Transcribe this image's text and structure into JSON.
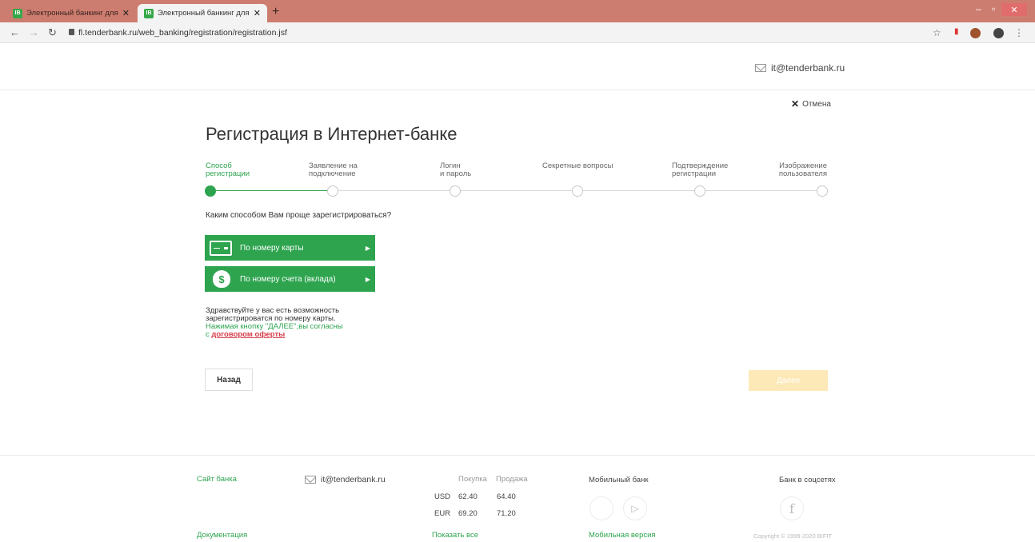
{
  "browser": {
    "tabs": [
      {
        "favicon": "IB",
        "title": "Электронный банкинг для част"
      },
      {
        "favicon": "IB",
        "title": "Электронный банкинг для част"
      }
    ],
    "url": "fl.tenderbank.ru/web_banking/registration/registration.jsf"
  },
  "header": {
    "email": "it@tenderbank.ru",
    "cancel_label": "Отмена"
  },
  "page": {
    "title": "Регистрация в Интернет-банке",
    "steps": [
      {
        "line1": "Способ",
        "line2": "регистрации"
      },
      {
        "line1": "Заявление на",
        "line2": "подключение"
      },
      {
        "line1": "Логин",
        "line2": "и пароль"
      },
      {
        "line1": "Секретные вопросы",
        "line2": ""
      },
      {
        "line1": "Подтверждение",
        "line2": "регистрации"
      },
      {
        "line1": "Изображение",
        "line2": "пользователя"
      }
    ],
    "question": "Каким способом Вам проще зарегистрироваться?",
    "methods": {
      "card": "По номеру карты",
      "account": "По номеру счета (вклада)"
    },
    "info": {
      "line1": "Здравствуйте у вас есть возможность",
      "line2": "зарегистрироватся по номеру карты.",
      "line3": "Нажимая кнопку \"ДАЛЕЕ\",вы согласны",
      "line4_prefix": "с ",
      "offer_link": "договором оферты"
    },
    "back_label": "Назад",
    "next_label": "Далее",
    "active_step": 0
  },
  "footer": {
    "site_link": "Сайт банка",
    "email": "it@tenderbank.ru",
    "rates": {
      "buy_label": "Покупка",
      "sell_label": "Продажа",
      "rows": [
        {
          "currency": "USD",
          "buy": "62.40",
          "sell": "64.40"
        },
        {
          "currency": "EUR",
          "buy": "69.20",
          "sell": "71.20"
        }
      ],
      "show_all": "Показать все"
    },
    "mobile_title": "Мобильный банк",
    "mobile_version": "Мобильная версия",
    "social_title": "Банк в соцсетях",
    "docs_link": "Документация",
    "copyright": "Copyright © 1999-2020 BIFIT"
  },
  "colors": {
    "accent": "#2ea44f",
    "tabstrip": "#cd7d6f",
    "next_disabled": "#fde9b7",
    "link_red": "#d73a49"
  }
}
